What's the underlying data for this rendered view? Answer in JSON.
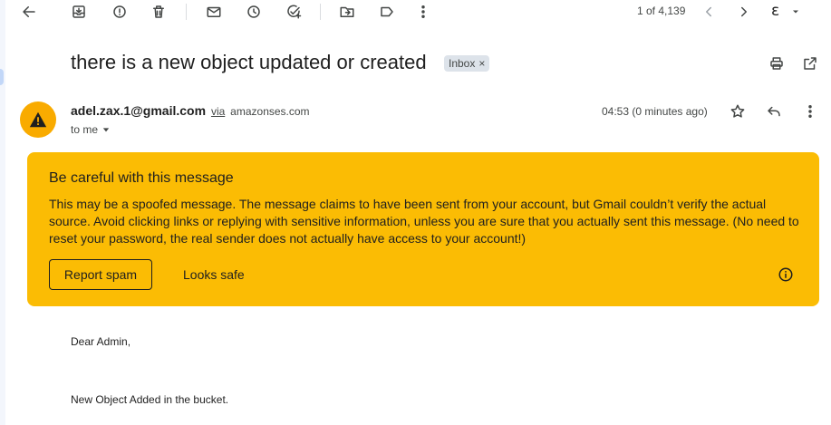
{
  "toolbar": {
    "counter": "1 of 4,139",
    "lang": "ε",
    "icons": [
      "back-arrow-icon",
      "archive-icon",
      "report-icon",
      "delete-icon",
      "mark-unread-icon",
      "snooze-icon",
      "add-task-icon",
      "move-to-icon",
      "label-icon",
      "more-vert-icon",
      "prev-icon",
      "next-icon",
      "dropdown-icon"
    ]
  },
  "message": {
    "subject": "there is a new object updated or created",
    "label_chip": "Inbox",
    "chip_remove": "×",
    "sender_email": "adel.zax.1@gmail.com",
    "via": "via",
    "via_domain": "amazonses.com",
    "to": "to me",
    "timestamp": "04:53 (0 minutes ago)"
  },
  "warning": {
    "title": "Be careful with this message",
    "body": "This may be a spoofed message. The message claims to have been sent from your account, but Gmail couldn’t verify the actual source. Avoid clicking links or replying with sensitive information, unless you are sure that you actually sent this message. (No need to reset your password, the real sender does not actually have access to your account!)",
    "report_spam": "Report spam",
    "looks_safe": "Looks safe"
  },
  "body": {
    "greeting": "Dear Admin,",
    "line1": "New Object Added in the bucket."
  },
  "colors": {
    "warning_bg": "#fbbc04",
    "avatar_bg": "#f9ab00",
    "chip_bg": "#dde3ea"
  }
}
